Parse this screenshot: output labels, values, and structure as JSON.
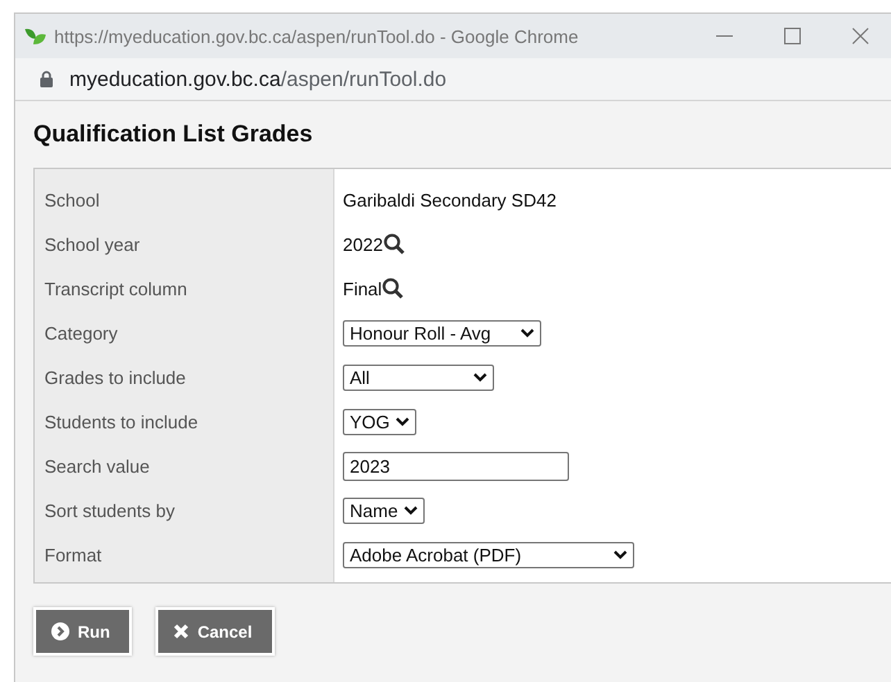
{
  "window": {
    "title": "https://myeducation.gov.bc.ca/aspen/runTool.do - Google Chrome"
  },
  "address_bar": {
    "host": "myeducation.gov.bc.ca",
    "path": "/aspen/runTool.do"
  },
  "heading": "Qualification List Grades",
  "fields": [
    {
      "label": "School",
      "kind": "text",
      "value": "Garibaldi Secondary SD42"
    },
    {
      "label": "School year",
      "kind": "lookup",
      "value": "2022"
    },
    {
      "label": "Transcript column",
      "kind": "lookup",
      "value": "Final"
    },
    {
      "label": "Category",
      "kind": "select",
      "value": "Honour Roll - Avg"
    },
    {
      "label": "Grades to include",
      "kind": "select",
      "value": "All"
    },
    {
      "label": "Students to include",
      "kind": "select",
      "value": "YOG"
    },
    {
      "label": "Search value",
      "kind": "input",
      "value": "2023"
    },
    {
      "label": "Sort students by",
      "kind": "select",
      "value": "Name"
    },
    {
      "label": "Format",
      "kind": "select",
      "value": "Adobe Acrobat (PDF)"
    }
  ],
  "buttons": [
    {
      "label": "Run",
      "kind": "run"
    },
    {
      "label": "Cancel",
      "kind": "cancel"
    }
  ]
}
